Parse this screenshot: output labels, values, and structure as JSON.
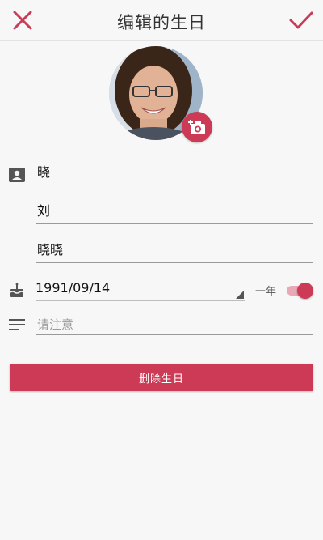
{
  "header": {
    "title": "编辑的生日",
    "close_icon": "close-icon",
    "confirm_icon": "checkmark-icon"
  },
  "avatar": {
    "camera_icon": "add-photo-camera-icon"
  },
  "form": {
    "first_name": "晓",
    "last_name": "刘",
    "nickname": "晓晓",
    "birthday": "1991/09/14",
    "year_label": "一年",
    "year_toggle_on": true,
    "note_placeholder": "请注意"
  },
  "actions": {
    "delete_label": "删除生日"
  },
  "colors": {
    "accent": "#cc3a55",
    "toggle_track": "#e8a8b6",
    "background": "#f7f7f7"
  }
}
